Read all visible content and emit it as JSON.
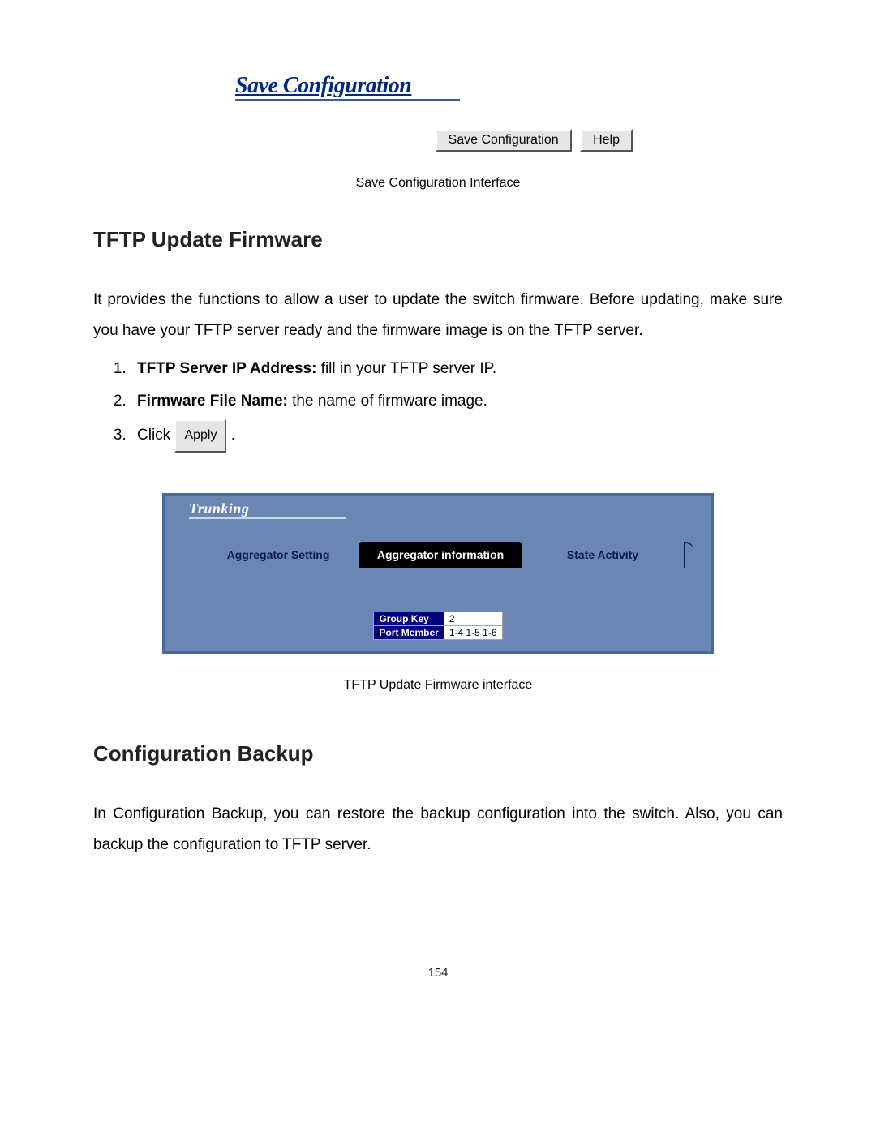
{
  "saveConfig": {
    "title": "Save Configuration",
    "saveButton": "Save Configuration",
    "helpButton": "Help",
    "caption": "Save Configuration Interface"
  },
  "tftp": {
    "heading": "TFTP Update Firmware",
    "intro": "It provides the functions to allow a user to update the switch firmware. Before updating, make sure you have your TFTP server ready and the firmware image is on the TFTP server.",
    "step1Bold": "TFTP Server IP Address:",
    "step1Rest": " fill in your TFTP server IP.",
    "step2Bold": "Firmware File Name:",
    "step2Rest": " the name of firmware image.",
    "step3Pre": "Click ",
    "applyLabel": "Apply",
    "step3Post": " ."
  },
  "trunking": {
    "title": "Trunking",
    "tab1": "Aggregator Setting",
    "tab2": "Aggregator information",
    "tab3": "State Activity",
    "groupKeyLabel": "Group Key",
    "groupKeyValue": "2",
    "portMemberLabel": "Port Member",
    "portMemberValue": "1-4 1-5 1-6",
    "caption": "TFTP Update Firmware interface"
  },
  "backup": {
    "heading": "Configuration Backup",
    "body": "In Configuration Backup, you can restore the backup configuration into the switch. Also, you can backup the configuration to TFTP server."
  },
  "pageNumber": "154"
}
